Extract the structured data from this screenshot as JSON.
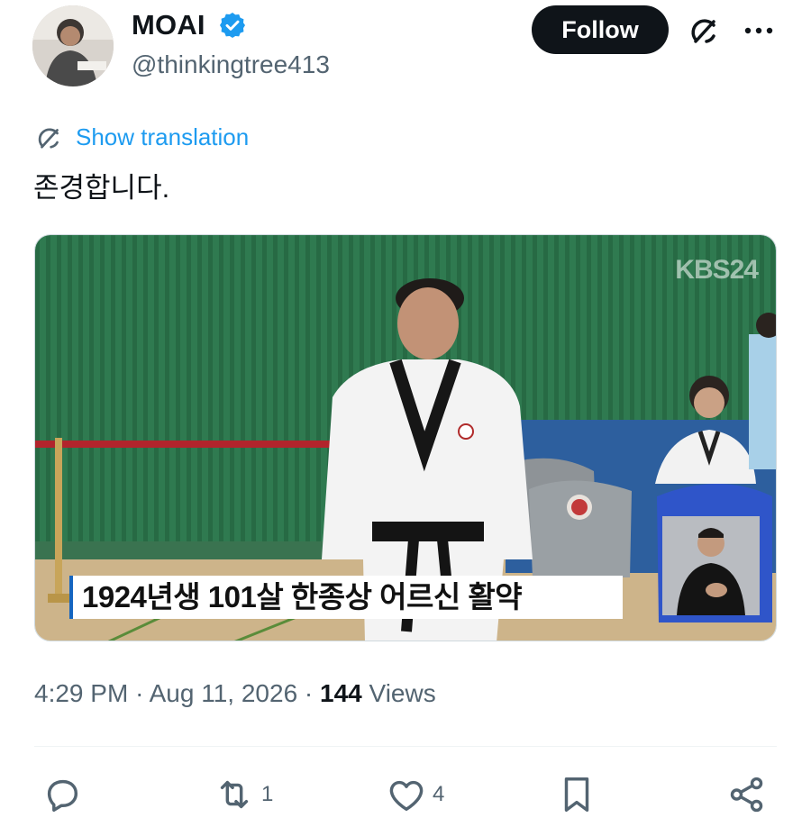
{
  "author": {
    "display_name": "MOAI",
    "handle": "@thinkingtree413",
    "verified": true,
    "follow_label": "Follow"
  },
  "icons": {
    "verified": "verified-badge-icon",
    "grok": "grok-icon",
    "more": "more-icon",
    "translate": "translate-icon",
    "reply": "reply-icon",
    "repost": "repost-icon",
    "like": "heart-icon",
    "bookmark": "bookmark-icon",
    "share": "share-icon"
  },
  "translation": {
    "label": "Show translation"
  },
  "tweet": {
    "text": "존경합니다."
  },
  "media": {
    "caption": "1924년생 101살 한종상 어르신 활약",
    "broadcaster_logo": "KBS24"
  },
  "meta": {
    "time": "4:29 PM",
    "separator1": "·",
    "date": "Aug 11, 2026",
    "separator2": "·",
    "views_count": "144",
    "views_label": "Views"
  },
  "actions": {
    "replies": "",
    "reposts": "1",
    "likes": "4"
  },
  "colors": {
    "accent": "#1d9bf0",
    "text_primary": "#0f1419",
    "text_secondary": "#536471",
    "follow_bg": "#0f1419"
  }
}
